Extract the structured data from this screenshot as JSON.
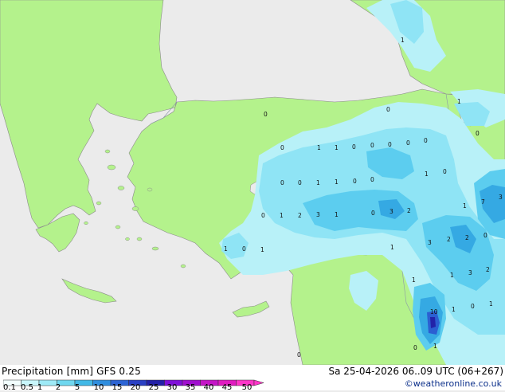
{
  "legend": {
    "title": "Precipitation [mm]  GFS 0.25",
    "valid_time": "Sa 25-04-2026 06..09 UTC (06+267)",
    "credit": "©weatheronline.co.uk",
    "ticks": [
      "0.1",
      "0.5",
      "1",
      "2",
      "5",
      "10",
      "15",
      "20",
      "25",
      "30",
      "35",
      "40",
      "45",
      "50"
    ],
    "colors": [
      "#f2ffff",
      "#c8f6fb",
      "#9eeaf6",
      "#6fd7ef",
      "#42b8e6",
      "#2f8ede",
      "#2c64d4",
      "#2a40c4",
      "#2320a8",
      "#7f10d8",
      "#a00fcf",
      "#c414c6",
      "#e01bc0",
      "#ff35c8"
    ]
  },
  "map": {
    "land_color": "#b4f28c",
    "sea_color": "#ebebeb",
    "coast_color": "#8b8b8b",
    "border_color": "#8a96a8",
    "precip_colors": [
      "#b8f1f8",
      "#8fe4f5",
      "#5ccdef",
      "#35a9e3",
      "#2b5fd2",
      "#2222a8"
    ],
    "labels": [
      "1",
      "0",
      "0",
      "0",
      "1",
      "1",
      "0",
      "0",
      "0",
      "0",
      "0",
      "0",
      "0",
      "1",
      "1",
      "0",
      "0",
      "1",
      "0",
      "0",
      "1",
      "2",
      "3",
      "1",
      "0",
      "3",
      "2",
      "1",
      "0",
      "1",
      "3",
      "2",
      "2",
      "1",
      "7",
      "3",
      "0",
      "1",
      "3",
      "2",
      "1",
      "10",
      "1",
      "0",
      "1",
      "0",
      "1",
      "0",
      "1",
      "1",
      "0"
    ]
  }
}
